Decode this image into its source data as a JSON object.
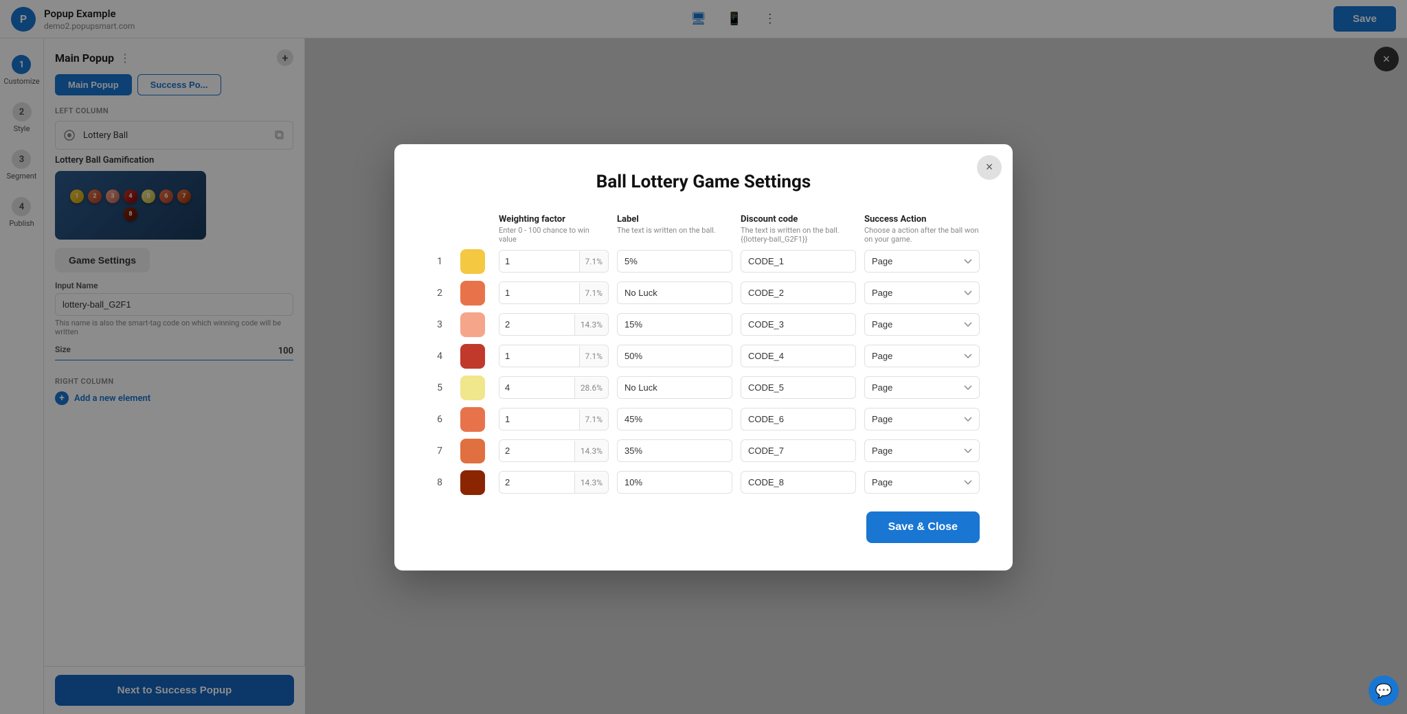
{
  "header": {
    "logo_text": "P",
    "title": "Popup Example",
    "subtitle": "demo2.popupsmart.com",
    "save_label": "Save",
    "device_desktop": "🖥",
    "device_mobile": "📱"
  },
  "steps": [
    {
      "num": "1",
      "label": "Customize",
      "active": true
    },
    {
      "num": "2",
      "label": "Style"
    },
    {
      "num": "3",
      "label": "Segment"
    },
    {
      "num": "4",
      "label": "Publish"
    }
  ],
  "panel": {
    "title": "Main Popup",
    "tabs": [
      {
        "label": "Main Popup",
        "active": true
      },
      {
        "label": "Success Po..."
      }
    ],
    "left_column_label": "LEFT COLUMN",
    "element_name": "Lottery Ball",
    "gamification_label": "Lottery Ball Gamification",
    "game_settings_label": "Game Settings",
    "input_name_label": "Input Name",
    "input_name_value": "lottery-ball_G2F1",
    "input_name_hint": "This name is also the smart-tag code on which winning code will be written",
    "size_label": "Size",
    "size_value": "100",
    "right_column_label": "RIGHT COLUMN",
    "add_element_label": "Add a new element",
    "next_btn_label": "Next to Success Popup"
  },
  "balls_preview": [
    {
      "color": "#f5c842"
    },
    {
      "color": "#e8734a"
    },
    {
      "color": "#f5a58a"
    },
    {
      "color": "#c0392b"
    },
    {
      "color": "#f0e68c"
    },
    {
      "color": "#e8734a"
    },
    {
      "color": "#e07040"
    },
    {
      "color": "#8b2500"
    }
  ],
  "modal": {
    "title": "Ball Lottery Game Settings",
    "close_label": "×",
    "columns": {
      "weighting_factor": {
        "header": "Weighting factor",
        "subtext": "Enter 0 - 100 chance to win value"
      },
      "label": {
        "header": "Label",
        "subtext": "The text is written on the ball."
      },
      "discount_code": {
        "header": "Discount code",
        "subtext": "The text is written on the ball.{{lottery-ball_G2F1}}"
      },
      "success_action": {
        "header": "Success Action",
        "subtext": "Choose a action after the ball won on your game."
      }
    },
    "rows": [
      {
        "num": 1,
        "color": "#f5c842",
        "weight": 1,
        "pct": "7.1%",
        "label": "5%",
        "code": "CODE_1",
        "action": "Page"
      },
      {
        "num": 2,
        "color": "#e8734a",
        "weight": 1,
        "pct": "7.1%",
        "label": "No Luck",
        "code": "CODE_2",
        "action": "Page"
      },
      {
        "num": 3,
        "color": "#f5a58a",
        "weight": 2,
        "pct": "14.3%",
        "label": "15%",
        "code": "CODE_3",
        "action": "Page"
      },
      {
        "num": 4,
        "color": "#c0392b",
        "weight": 1,
        "pct": "7.1%",
        "label": "50%",
        "code": "CODE_4",
        "action": "Page"
      },
      {
        "num": 5,
        "color": "#f0e68c",
        "weight": 4,
        "pct": "28.6%",
        "label": "No Luck",
        "code": "CODE_5",
        "action": "Page"
      },
      {
        "num": 6,
        "color": "#e8734a",
        "weight": 1,
        "pct": "7.1%",
        "label": "45%",
        "code": "CODE_6",
        "action": "Page"
      },
      {
        "num": 7,
        "color": "#e07040",
        "weight": 2,
        "pct": "14.3%",
        "label": "35%",
        "code": "CODE_7",
        "action": "Page"
      },
      {
        "num": 8,
        "color": "#8b2500",
        "weight": 2,
        "pct": "14.3%",
        "label": "10%",
        "code": "CODE_8",
        "action": "Page"
      }
    ],
    "save_close_label": "Save & Close"
  }
}
